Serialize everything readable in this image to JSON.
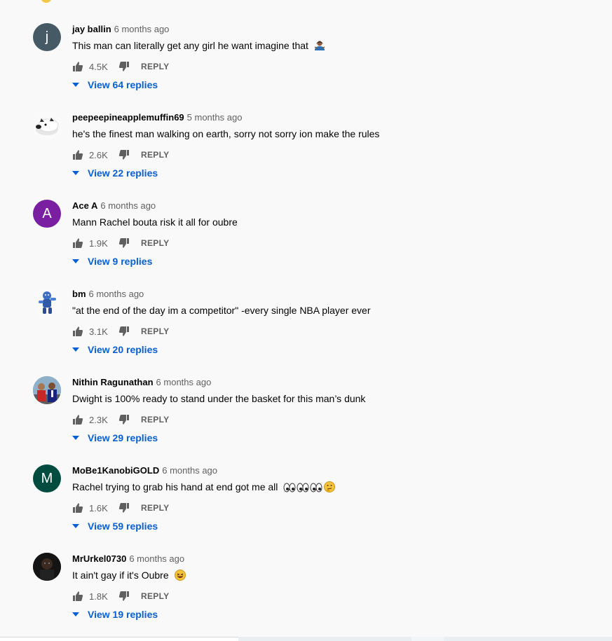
{
  "comments": [
    {
      "author": "jay ballin",
      "time": "6 months ago",
      "text": "This man can literally get any girl he want imagine that",
      "emoji": "person-shrugging",
      "likes": "4.5K",
      "reply_label": "REPLY",
      "view_replies": "View 64 replies",
      "avatar": {
        "type": "letter",
        "letter": "j",
        "color": "#455a64"
      }
    },
    {
      "author": "peepeepineapplemuffin69",
      "time": "5 months ago",
      "text": "he's the finest man walking on earth, sorry not sorry ion make the rules",
      "likes": "2.6K",
      "reply_label": "REPLY",
      "view_replies": "View 22 replies",
      "avatar": {
        "type": "image",
        "name": "dog-photo"
      }
    },
    {
      "author": "Ace A",
      "time": "6 months ago",
      "text": "Mann Rachel bouta risk it all for oubre",
      "likes": "1.9K",
      "reply_label": "REPLY",
      "view_replies": "View 9 replies",
      "avatar": {
        "type": "letter",
        "letter": "A",
        "color": "#7b1fa2"
      }
    },
    {
      "author": "bm",
      "time": "6 months ago",
      "text": "\"at the end of the day im a competitor\" -every single NBA player ever",
      "likes": "3.1K",
      "reply_label": "REPLY",
      "view_replies": "View 20 replies",
      "avatar": {
        "type": "image",
        "name": "blue-baby-figure"
      }
    },
    {
      "author": "Nithin Ragunathan",
      "time": "6 months ago",
      "text": "Dwight is 100% ready to stand under the basket for this man’s dunk",
      "likes": "2.3K",
      "reply_label": "REPLY",
      "view_replies": "View 29 replies",
      "avatar": {
        "type": "image",
        "name": "people-photo"
      }
    },
    {
      "author": "MoBe1KanobiGOLD",
      "time": "6 months ago",
      "text": "Rachel trying to grab his hand at end got me all",
      "emoji": "eyes-eyes-eyes-thinking",
      "likes": "1.6K",
      "reply_label": "REPLY",
      "view_replies": "View 59 replies",
      "avatar": {
        "type": "letter",
        "letter": "M",
        "color": "#004d40"
      }
    },
    {
      "author": "MrUrkel0730",
      "time": "6 months ago",
      "text": "It ain't gay if it's Oubre",
      "emoji": "laughing",
      "likes": "1.8K",
      "reply_label": "REPLY",
      "view_replies": "View 19 replies",
      "avatar": {
        "type": "image",
        "name": "dark-photo"
      }
    }
  ],
  "colors": {
    "background": "#f9f9f9",
    "link": "#065fd4",
    "secondary_text": "#606060"
  }
}
